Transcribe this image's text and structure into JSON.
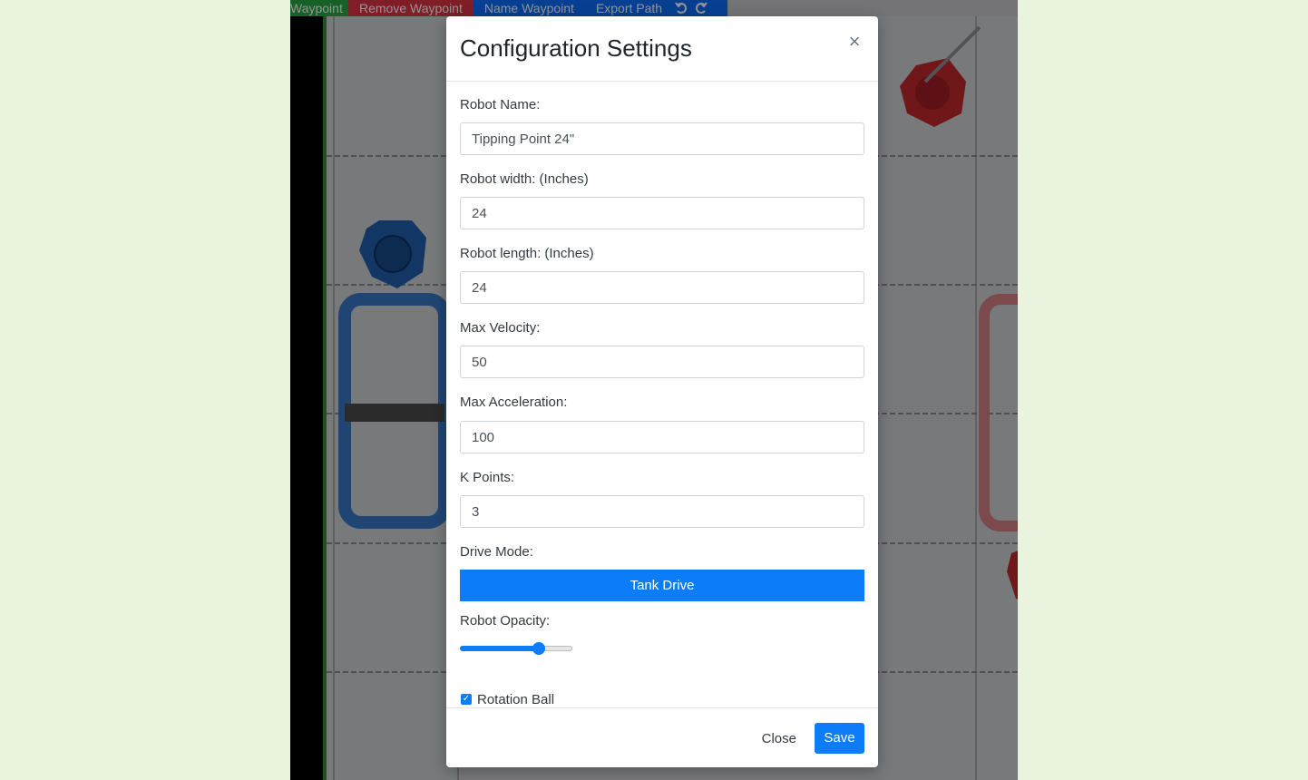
{
  "toolbar": {
    "add_waypoint": "Waypoint",
    "remove_waypoint": "Remove Waypoint",
    "name_waypoint": "Name Waypoint",
    "export_path": "Export Path",
    "undo_icon": "undo-icon",
    "redo_icon": "redo-icon"
  },
  "modal": {
    "title": "Configuration Settings",
    "close_icon": "×",
    "fields": {
      "robot_name": {
        "label": "Robot Name:",
        "value": "Tipping Point 24\""
      },
      "robot_width": {
        "label": "Robot width: (Inches)",
        "value": "24"
      },
      "robot_length": {
        "label": "Robot length: (Inches)",
        "value": "24"
      },
      "max_velocity": {
        "label": "Max Velocity:",
        "value": "50"
      },
      "max_acceleration": {
        "label": "Max Acceleration:",
        "value": "100"
      },
      "k_points": {
        "label": "K Points:",
        "value": "3"
      }
    },
    "drive_mode": {
      "label": "Drive Mode:",
      "value": "Tank Drive"
    },
    "robot_opacity": {
      "label": "Robot Opacity:",
      "value": 0.7
    },
    "rotation_ball": {
      "label": "Rotation Ball",
      "checked": true
    },
    "footer": {
      "close_label": "Close",
      "save_label": "Save"
    }
  },
  "colors": {
    "primary": "#0d7cf8",
    "toolbar_green": "#28a745",
    "toolbar_red": "#dc3545",
    "toolbar_blue": "#0d6efd",
    "page_background": "#e9f3de"
  }
}
